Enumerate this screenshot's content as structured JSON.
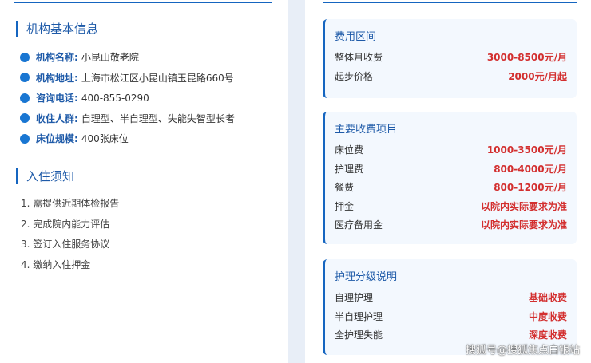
{
  "institution": {
    "title": "机构基本信息",
    "items": [
      {
        "label": "机构名称:",
        "value": "小昆山敬老院"
      },
      {
        "label": "机构地址:",
        "value": "上海市松江区小昆山镇玉昆路660号"
      },
      {
        "label": "咨询电话:",
        "value": "400-855-0290"
      },
      {
        "label": "收住人群:",
        "value": "自理型、半自理型、失能失智型长者"
      },
      {
        "label": "床位规模:",
        "value": "400张床位"
      }
    ]
  },
  "notice": {
    "title": "入住须知",
    "items": [
      "1. 需提供近期体检报告",
      "2. 完成院内能力评估",
      "3. 签订入住服务协议",
      "4. 缴纳入住押金"
    ]
  },
  "fee_range": {
    "title": "费用区间",
    "rows": [
      {
        "name": "整体月收费",
        "value": "3000-8500元/月"
      },
      {
        "name": "起步价格",
        "value": "2000元/月起"
      }
    ]
  },
  "main_fees": {
    "title": "主要收费项目",
    "rows": [
      {
        "name": "床位费",
        "value": "1000-3500元/月"
      },
      {
        "name": "护理费",
        "value": "800-4000元/月"
      },
      {
        "name": "餐费",
        "value": "800-1200元/月"
      },
      {
        "name": "押金",
        "value": "以院内实际要求为准"
      },
      {
        "name": "医疗备用金",
        "value": "以院内实际要求为准"
      }
    ]
  },
  "care_levels": {
    "title": "护理分级说明",
    "rows": [
      {
        "name": "自理护理",
        "value": "基础收费"
      },
      {
        "name": "半自理护理",
        "value": "中度收费"
      },
      {
        "name": "全护理失能",
        "value": "深度收费"
      }
    ]
  },
  "watermark": "搜狐号@搜狐焦点白银站"
}
